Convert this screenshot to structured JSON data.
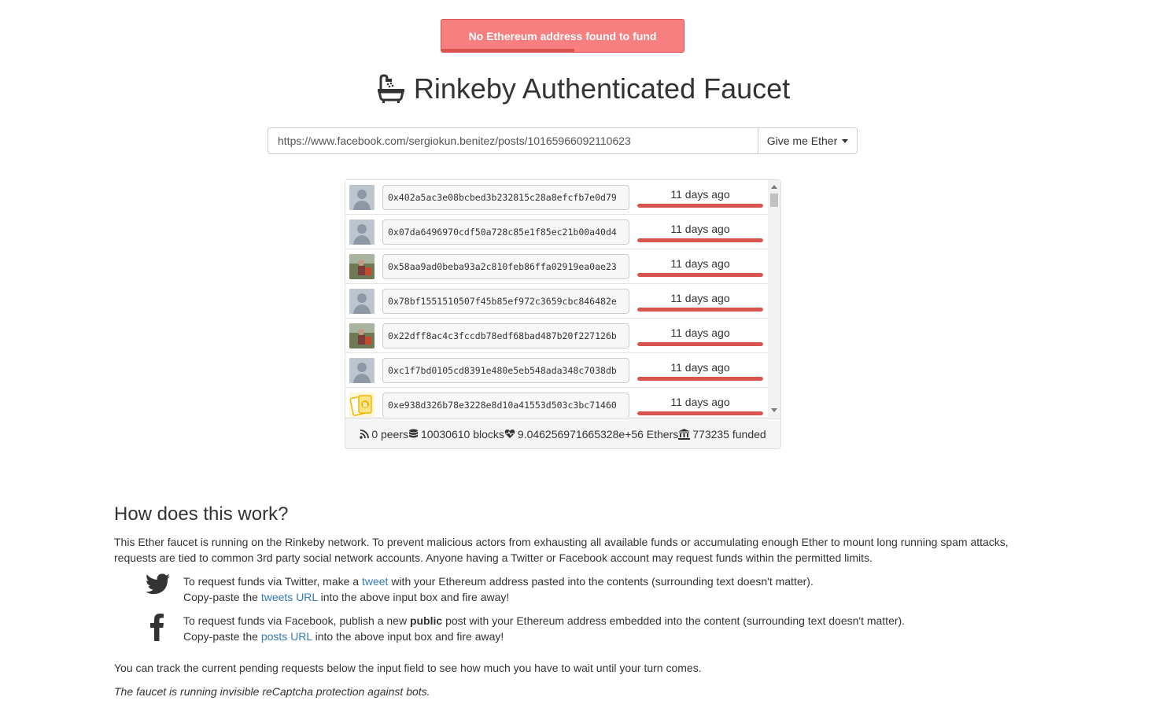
{
  "alert": {
    "message": "No Ethereum address found to fund",
    "color": "#f77f7f",
    "timer_progress": 0.55
  },
  "header": {
    "title": "Rinkeby Authenticated Faucet",
    "icon": "bath-icon"
  },
  "search": {
    "value": "https://www.facebook.com/sergiokun.benitez/posts/10165966092110623",
    "button_label": "Give me Ether"
  },
  "requests": [
    {
      "avatar": "default-avatar",
      "address": "0x402a5ac3e08bcbed3b232815c28a8efcfb7e0d79",
      "time": "11 days ago",
      "progress": 1.0
    },
    {
      "avatar": "default-avatar",
      "address": "0x07da6496970cdf50a728c85e1f85ec21b00a40d4",
      "time": "11 days ago",
      "progress": 1.0
    },
    {
      "avatar": "photo-avatar",
      "address": "0x58aa9ad0beba93a2c810feb86ffa02919ea0ae23",
      "time": "11 days ago",
      "progress": 1.0
    },
    {
      "avatar": "default-avatar",
      "address": "0x78bf1551510507f45b85ef972c3659cbc846482e",
      "time": "11 days ago",
      "progress": 1.0
    },
    {
      "avatar": "photo-avatar",
      "address": "0x22dff8ac4c3fccdb78edf68bad487b20f227126b",
      "time": "11 days ago",
      "progress": 1.0
    },
    {
      "avatar": "default-avatar",
      "address": "0xc1f7bd0105cd8391e480e5eb548ada348c7038db",
      "time": "11 days ago",
      "progress": 1.0
    },
    {
      "avatar": "bitcoin-avatar",
      "address": "0xe938d326b78e3228e8d10a41553d503c3bc71460",
      "time": "11 days ago",
      "progress": 1.0
    }
  ],
  "stats": {
    "peers": "0 peers",
    "blocks": "10030610 blocks",
    "ethers": "9.046256971665328e+56 Ethers",
    "funded": "773235 funded"
  },
  "howto": {
    "heading": "How does this work?",
    "intro": "This Ether faucet is running on the Rinkeby network. To prevent malicious actors from exhausting all available funds or accumulating enough Ether to mount long running spam attacks, requests are tied to common 3rd party social network accounts. Anyone having a Twitter or Facebook account may request funds within the permitted limits.",
    "twitter": {
      "pre": "To request funds via Twitter, make a ",
      "link": "tweet",
      "post": " with your Ethereum address pasted into the contents (surrounding text doesn't matter).",
      "line2_pre": "Copy-paste the ",
      "line2_link": "tweets URL",
      "line2_post": " into the above input box and fire away!"
    },
    "facebook": {
      "pre": "To request funds via Facebook, publish a new ",
      "bold": "public",
      "post": " post with your Ethereum address embedded into the content (surrounding text doesn't matter).",
      "line2_pre": "Copy-paste the ",
      "line2_link": "posts URL",
      "line2_post": " into the above input box and fire away!"
    },
    "track": "You can track the current pending requests below the input field to see how much you have to wait until your turn comes.",
    "captcha": "The faucet is running invisible reCaptcha protection against bots."
  },
  "colors": {
    "danger": "#d9534f",
    "link": "#337ab7"
  }
}
